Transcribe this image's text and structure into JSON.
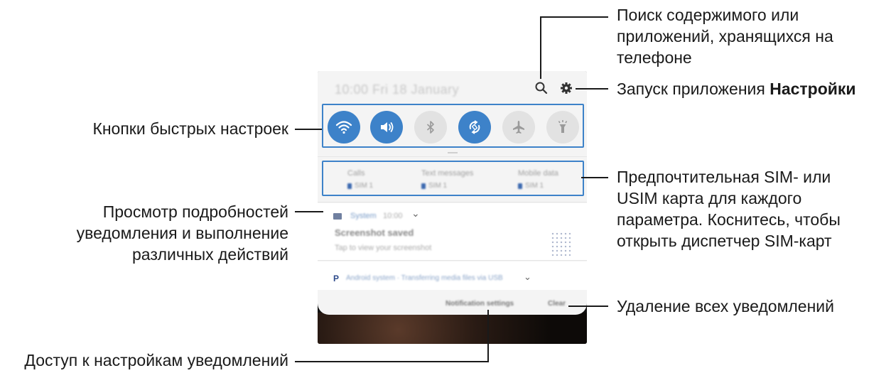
{
  "phone": {
    "time": "10:00  Fri 18 January",
    "quick_settings": [
      {
        "icon": "wifi-icon",
        "state": "on"
      },
      {
        "icon": "sound-icon",
        "state": "on"
      },
      {
        "icon": "bluetooth-icon",
        "state": "off"
      },
      {
        "icon": "auto-rotate-icon",
        "state": "on"
      },
      {
        "icon": "airplane-icon",
        "state": "off"
      },
      {
        "icon": "flashlight-icon",
        "state": "off"
      }
    ],
    "sim": [
      {
        "title": "Calls",
        "value": "SIM 1"
      },
      {
        "title": "Text messages",
        "value": "SIM 1"
      },
      {
        "title": "Mobile data",
        "value": "SIM 1"
      }
    ],
    "notification1": {
      "app": "System",
      "time": "10:00",
      "title": "Screenshot saved",
      "text": "Tap to view your screenshot"
    },
    "notification2": {
      "app": "Android system",
      "text": "Transferring media files via USB"
    },
    "footer": {
      "settings_label": "Notification settings",
      "clear_label": "Clear"
    }
  },
  "callouts": {
    "search": "Поиск содержимого или приложений, хранящихся на телефоне",
    "settings_prefix": "Запуск приложения ",
    "settings_bold": "Настройки",
    "quick_buttons": "Кнопки быстрых настроек",
    "sim_pref": "Предпочтительная SIM- или USIM карта для каждого параметра. Коснитесь, чтобы открыть диспетчер SIM-карт",
    "notif_details": "Просмотр подробностей уведомления и выполнение различных действий",
    "clear_all": "Удаление всех уведомлений",
    "notif_settings": "Доступ к настройкам уведомлений"
  },
  "colors": {
    "accent": "#3d82c9",
    "toggle_off": "#e2e2e2"
  }
}
